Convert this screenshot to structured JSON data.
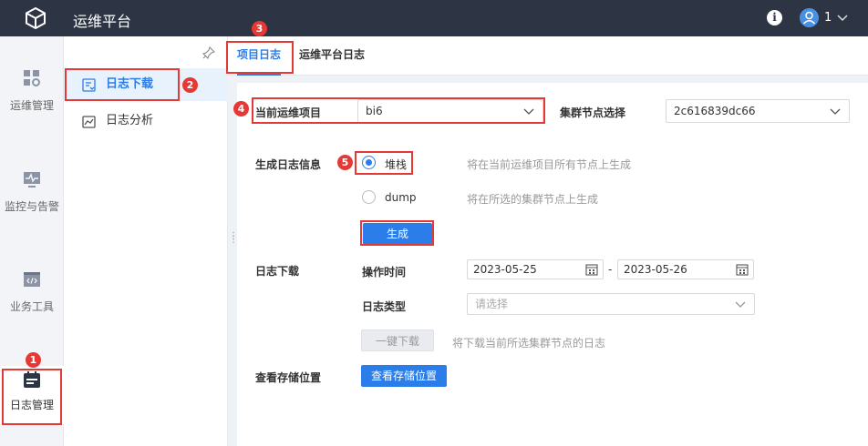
{
  "header": {
    "title": "运维平台",
    "info_icon": "info-icon",
    "user_count": "1"
  },
  "rail": {
    "items": [
      {
        "label": "运维管理",
        "icon": "grid-gear-icon"
      },
      {
        "label": "监控与告警",
        "icon": "monitor-pulse-icon"
      },
      {
        "label": "业务工具",
        "icon": "code-window-icon"
      },
      {
        "label": "日志管理",
        "icon": "calendar-log-icon",
        "active": true
      }
    ]
  },
  "submenu": {
    "items": [
      {
        "label": "日志下载",
        "icon": "download-log-icon",
        "active": true
      },
      {
        "label": "日志分析",
        "icon": "chart-log-icon"
      }
    ]
  },
  "tabs": [
    {
      "label": "项目日志",
      "active": true
    },
    {
      "label": "运维平台日志"
    }
  ],
  "form": {
    "project_label": "当前运维项目",
    "project_value": "bi6",
    "cluster_label": "集群节点选择",
    "cluster_value": "2c616839dc66",
    "gen_label": "生成日志信息",
    "opt1_label": "堆栈",
    "opt1_hint": "将在当前运维项目所有节点上生成",
    "opt2_label": "dump",
    "opt2_hint": "将在所选的集群节点上生成",
    "generate_btn": "生成",
    "download_label": "日志下载",
    "op_time_label": "操作时间",
    "date_from": "2023-05-25",
    "date_sep": "-",
    "date_to": "2023-05-26",
    "log_type_label": "日志类型",
    "log_type_placeholder": "请选择",
    "oneclick_btn": "一键下载",
    "oneclick_hint": "将下载当前所选集群节点的日志",
    "storage_label": "查看存储位置",
    "storage_btn": "查看存储位置"
  },
  "badges": [
    "1",
    "2",
    "3",
    "4",
    "5"
  ],
  "colors": {
    "accent": "#2b7de9",
    "topbar": "#2d3443",
    "highlight": "#e53935"
  }
}
